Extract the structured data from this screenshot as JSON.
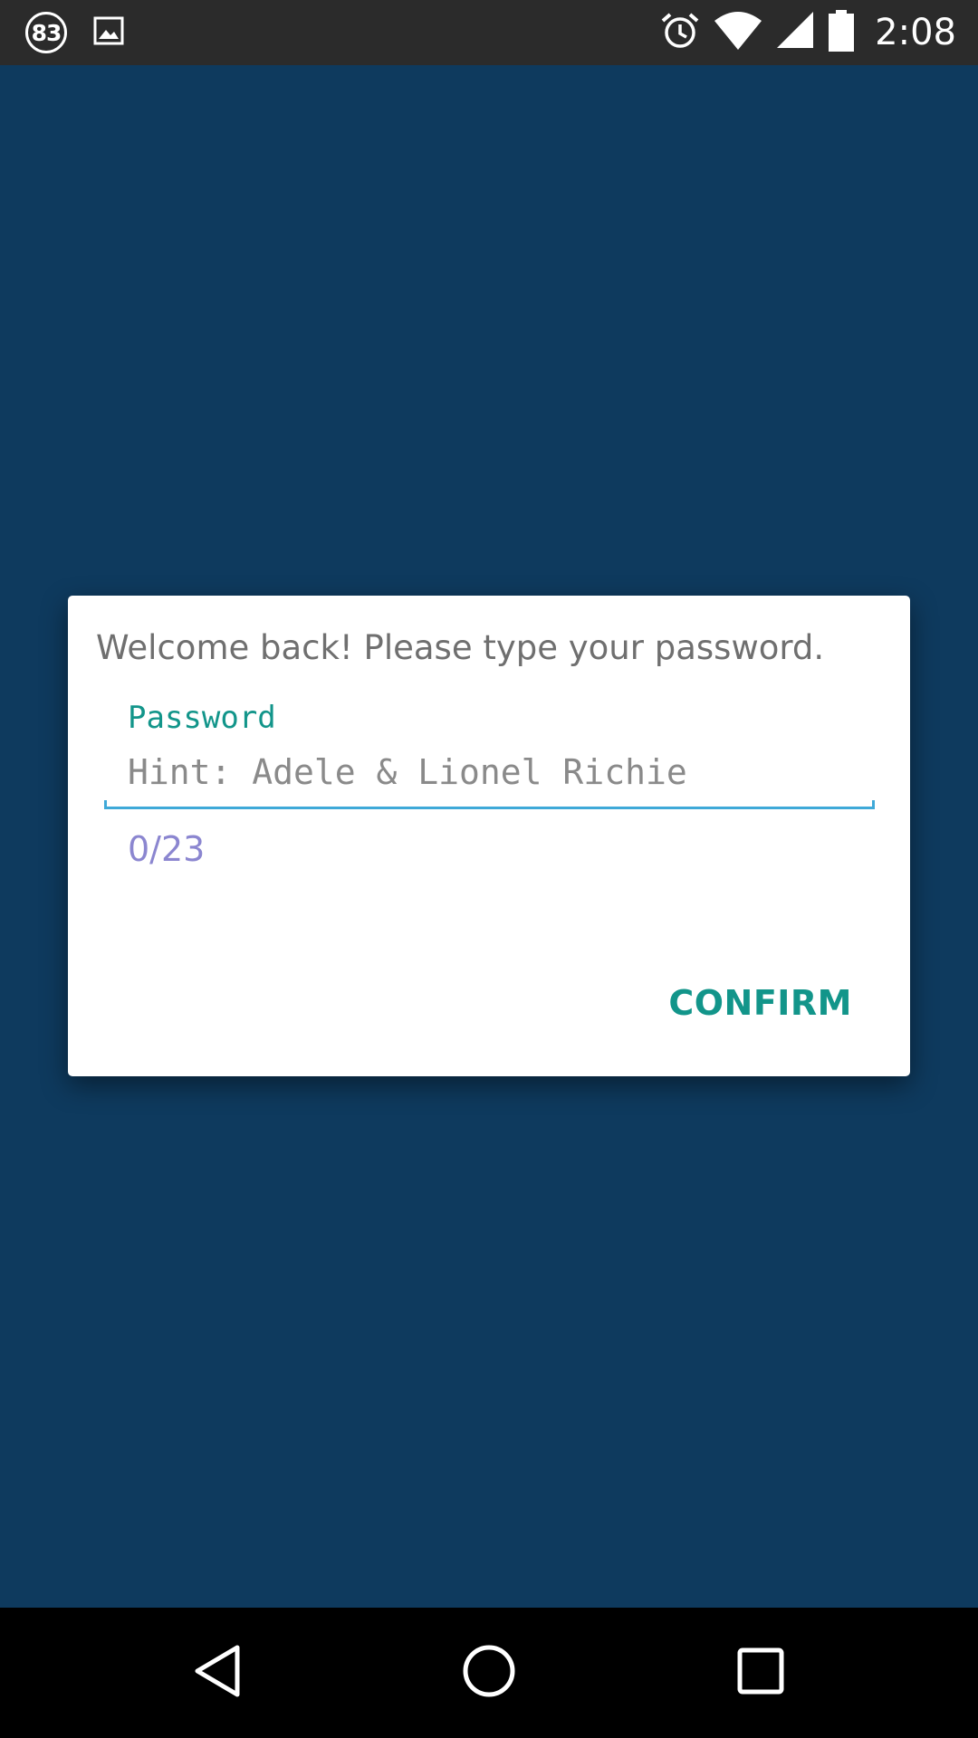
{
  "status_bar": {
    "notification_count": "83",
    "notification_icons": [
      "count-badge-icon",
      "image-icon"
    ],
    "system_icons": [
      "alarm-icon",
      "wifi-icon",
      "cell-signal-icon",
      "battery-icon"
    ],
    "time": "2:08"
  },
  "dialog": {
    "message": "Welcome back! Please type your password.",
    "password_field": {
      "label": "Password",
      "value": "",
      "placeholder": "Hint: Adele & Lionel Richie"
    },
    "char_counter": "0/23",
    "confirm_label": "CONFIRM"
  },
  "nav_bar": {
    "buttons": [
      "back-icon",
      "home-icon",
      "recents-icon"
    ]
  },
  "colors": {
    "background": "#0e3a5e",
    "accent": "#12958a",
    "input_underline": "#3fa9d8",
    "counter": "#8b86d0"
  }
}
